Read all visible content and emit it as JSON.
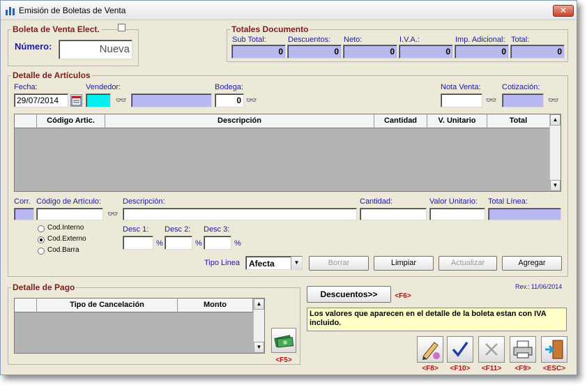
{
  "window": {
    "title": "Emisión de Boletas de Venta"
  },
  "boleta": {
    "legend": "Boleta de Venta",
    "elect_label": "Elect.",
    "numero_label": "Número:",
    "numero_value": "Nueva"
  },
  "totales": {
    "legend": "Totales Documento",
    "fields": [
      {
        "label": "Sub Total:",
        "value": "0"
      },
      {
        "label": "Descuentos:",
        "value": "0"
      },
      {
        "label": "Neto:",
        "value": "0"
      },
      {
        "label": "I.V.A.:",
        "value": "0"
      },
      {
        "label": "Imp. Adicional:",
        "value": "0"
      },
      {
        "label": "Total:",
        "value": "0"
      }
    ]
  },
  "detalle": {
    "legend": "Detalle de Artículos",
    "fecha_label": "Fecha:",
    "fecha_value": "29/07/2014",
    "vendedor_label": "Vendedor:",
    "bodega_label": "Bodega:",
    "bodega_value": "0",
    "nota_venta_label": "Nota Venta:",
    "cotizacion_label": "Cotización:",
    "grid_headers": [
      "Código Artic.",
      "Descripción",
      "Cantidad",
      "V. Unitario",
      "Total"
    ],
    "corr_label": "Corr.",
    "codigo_label": "Código de Artículo:",
    "descripcion_label": "Descripción:",
    "cantidad_label": "Cantidad:",
    "valor_unitario_label": "Valor Unitario:",
    "total_linea_label": "Total Línea:",
    "code_types": [
      "Cod.Interno",
      "Cod.Externo",
      "Cod.Barra"
    ],
    "code_type_selected": "Cod.Externo",
    "desc1_label": "Desc 1:",
    "desc2_label": "Desc 2:",
    "desc3_label": "Desc 3:",
    "pct": "%",
    "tipo_linea_label": "Tipo Linea",
    "tipo_linea_value": "Afecta",
    "buttons": {
      "borrar": "Borrar",
      "limpiar": "Limpiar",
      "actualizar": "Actualizar",
      "agregar": "Agregar"
    }
  },
  "pago": {
    "legend": "Detalle de Pago",
    "grid_headers": [
      "Tipo de Cancelación",
      "Monto"
    ],
    "f5": "<F5>"
  },
  "descuentos_button": "Descuentos>>",
  "descuentos_key": "<F6>",
  "revision": "Rev.: 11/06/2014",
  "info_message": "Los valores que aparecen en el detalle de la boleta estan con IVA incluido.",
  "actions": [
    {
      "icon": "edit-pencil-icon",
      "key": "<F8>"
    },
    {
      "icon": "check-icon",
      "key": "<F10>"
    },
    {
      "icon": "cancel-x-icon",
      "key": "<F11>"
    },
    {
      "icon": "printer-icon",
      "key": "<F9>"
    },
    {
      "icon": "exit-door-icon",
      "key": "<ESC>"
    }
  ],
  "colors": {
    "accent_lavender": "#b8b8f0",
    "vendedor_cyan": "#00f0f0",
    "legend_red": "#7a1f1f",
    "label_blue": "#1a1aa0",
    "info_yellow": "#ffffc8",
    "fkey_red": "#b01010"
  }
}
